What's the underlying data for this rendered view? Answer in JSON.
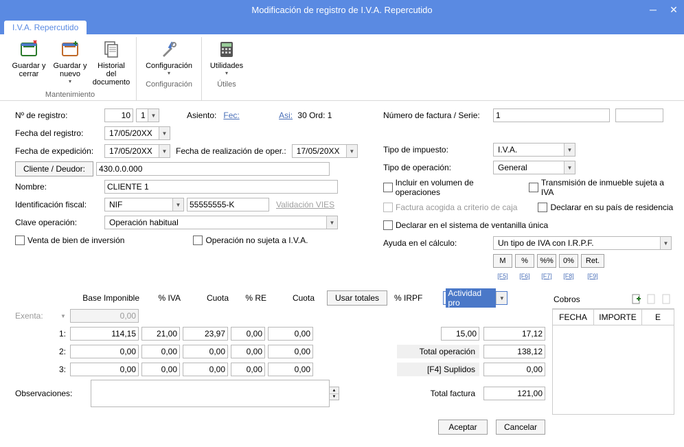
{
  "window": {
    "title": "Modificación de registro de I.V.A. Repercutido"
  },
  "tab": {
    "label": "I.V.A. Repercutido"
  },
  "ribbon": {
    "groups": [
      {
        "label": "Mantenimiento",
        "buttons": [
          {
            "label": "Guardar y cerrar",
            "name": "save-close-button"
          },
          {
            "label": "Guardar y nuevo",
            "name": "save-new-button",
            "dropdown": true
          },
          {
            "label": "Historial del documento",
            "name": "history-button"
          }
        ]
      },
      {
        "label": "Configuración",
        "buttons": [
          {
            "label": "Configuración",
            "name": "config-button",
            "dropdown": true
          }
        ]
      },
      {
        "label": "Útiles",
        "buttons": [
          {
            "label": "Utilidades",
            "name": "utilities-button",
            "dropdown": true
          }
        ]
      }
    ]
  },
  "left": {
    "nregistro_label": "Nº de registro:",
    "nregistro_value": "10",
    "nregistro_serie": "1",
    "asiento_label": "Asiento:",
    "asiento_fec": "Fec:",
    "asiento_rest": "Asi: 30 Ord: 1",
    "fecha_registro_label": "Fecha del registro:",
    "fecha_registro_value": "17/05/20XX",
    "fecha_exped_label": "Fecha de expedición:",
    "fecha_exped_value": "17/05/20XX",
    "fecha_realiz_label": "Fecha de realización de oper.:",
    "fecha_realiz_value": "17/05/20XX",
    "cliente_btn": "Cliente / Deudor:",
    "cliente_value": "430.0.0.000",
    "nombre_label": "Nombre:",
    "nombre_value": "CLIENTE 1",
    "idfiscal_label": "Identificación fiscal:",
    "idfiscal_tipo": "NIF",
    "idfiscal_value": "55555555-K",
    "validacion_vies": "Validación VIES",
    "clave_op_label": "Clave operación:",
    "clave_op_value": "Operación habitual",
    "chk_venta_inversion": "Venta de bien de inversión",
    "chk_op_no_sujeta": "Operación no sujeta a I.V.A."
  },
  "right": {
    "num_factura_label": "Número de factura / Serie:",
    "num_factura_value": "1",
    "tipo_impuesto_label": "Tipo de impuesto:",
    "tipo_impuesto_value": "I.V.A.",
    "tipo_operacion_label": "Tipo de operación:",
    "tipo_operacion_value": "General",
    "chk_incluir_volumen": "Incluir en volumen de operaciones",
    "chk_transmision": "Transmisión de inmueble sujeta a IVA",
    "chk_factura_caja": "Factura acogida a criterio de caja",
    "chk_declarar_pais": "Declarar en su país de residencia",
    "chk_ventanilla": "Declarar en el sistema de ventanilla única",
    "ayuda_label": "Ayuda en el cálculo:",
    "ayuda_value": "Un tipo de IVA con I.R.P.F.",
    "mini_btns": [
      "M",
      "%",
      "%%",
      "0%",
      "Ret."
    ],
    "mini_lbls": [
      "[F5]",
      "[F6]",
      "[F7]",
      "[F8]",
      "[F9]"
    ]
  },
  "grid": {
    "headers": [
      "Base Imponible",
      "% IVA",
      "Cuota",
      "% RE",
      "Cuota"
    ],
    "usar_totales": "Usar totales",
    "pct_irpf_label": "% IRPF",
    "actividad": "Actividad pro",
    "exenta_label": "Exenta:",
    "exenta_base": "0,00",
    "rows": [
      {
        "label": "1:",
        "base": "114,15",
        "iva": "21,00",
        "cuota": "23,97",
        "re": "0,00",
        "cuota2": "0,00"
      },
      {
        "label": "2:",
        "base": "0,00",
        "iva": "0,00",
        "cuota": "0,00",
        "re": "0,00",
        "cuota2": "0,00"
      },
      {
        "label": "3:",
        "base": "0,00",
        "iva": "0,00",
        "cuota": "0,00",
        "re": "0,00",
        "cuota2": "0,00"
      }
    ],
    "irpf_pct": "15,00",
    "irpf_val": "17,12",
    "total_op_label": "Total operación",
    "total_op": "138,12",
    "suplidos_label": "[F4] Suplidos",
    "suplidos": "0,00",
    "total_factura_label": "Total factura",
    "total_factura": "121,00",
    "observ_label": "Observaciones:"
  },
  "cobros": {
    "title": "Cobros",
    "cols": [
      "FECHA",
      "IMPORTE",
      "E"
    ]
  },
  "buttons": {
    "aceptar": "Aceptar",
    "cancelar": "Cancelar"
  }
}
